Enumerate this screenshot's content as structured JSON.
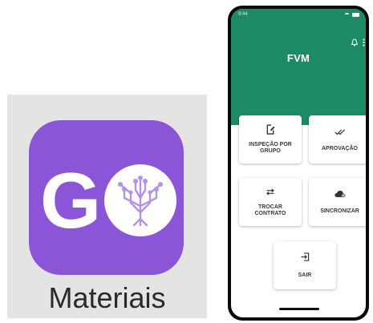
{
  "app_icon": {
    "logo_text": "GO",
    "label": "Materiais",
    "background_color": "#8a55d6"
  },
  "phone": {
    "status_bar": {
      "time": "9:44"
    },
    "header": {
      "title": "FVM",
      "background_color": "#1d8a66",
      "icons": [
        "bell-icon",
        "more-vert-icon"
      ]
    },
    "menu": [
      {
        "label": "INSPEÇÃO POR GRUPO",
        "icon": "clipboard-edit-icon"
      },
      {
        "label": "APROVAÇÃO",
        "icon": "double-check-icon"
      },
      {
        "label": "TROCAR CONTRATO",
        "icon": "swap-arrows-icon"
      },
      {
        "label": "SINCRONIZAR",
        "icon": "cloud-sync-icon"
      },
      {
        "label": "SAIR",
        "icon": "logout-icon"
      }
    ]
  }
}
